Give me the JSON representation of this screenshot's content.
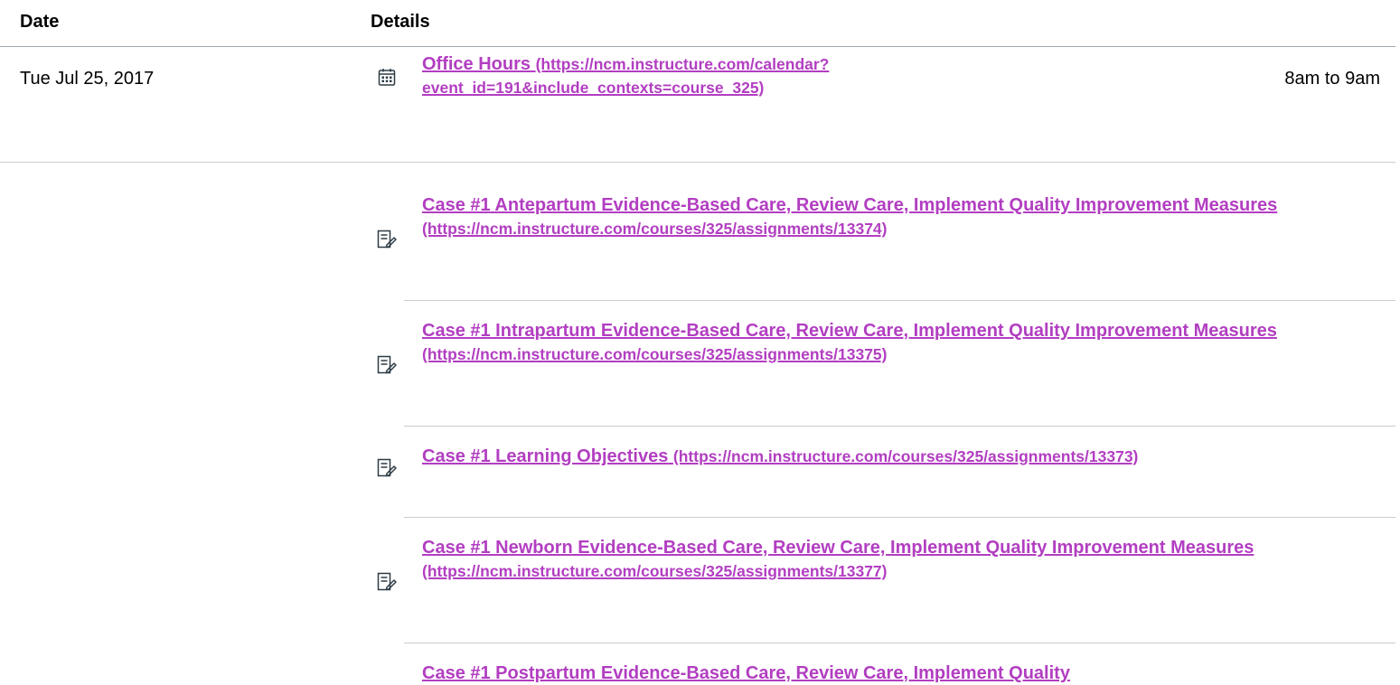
{
  "table": {
    "header": {
      "date_label": "Date",
      "details_label": "Details"
    },
    "rows": [
      {
        "date": "Tue Jul 25, 2017",
        "items": [
          {
            "type": "calendar-event",
            "icon": "calendar-icon",
            "title": "Office Hours",
            "url": "(https://ncm.instructure.com/calendar?event_id=191&include_contexts=course_325)",
            "time": "8am to 9am"
          }
        ]
      },
      {
        "date": "",
        "items": [
          {
            "type": "assignment",
            "icon": "assignment-icon",
            "title": "Case #1 Antepartum Evidence-Based Care, Review Care, Implement Quality Improvement Measures",
            "url": "(https://ncm.instructure.com/courses/325/assignments/13374)"
          },
          {
            "type": "assignment",
            "icon": "assignment-icon",
            "title": "Case #1 Intrapartum Evidence-Based Care, Review Care, Implement Quality Improvement Measures",
            "url": "(https://ncm.instructure.com/courses/325/assignments/13375)"
          },
          {
            "type": "assignment",
            "icon": "assignment-icon",
            "title": "Case #1 Learning Objectives",
            "url": "(https://ncm.instructure.com/courses/325/assignments/13373)"
          },
          {
            "type": "assignment",
            "icon": "assignment-icon",
            "title": "Case #1 Newborn Evidence-Based Care, Review Care, Implement Quality Improvement Measures",
            "url": "(https://ncm.instructure.com/courses/325/assignments/13377)"
          },
          {
            "type": "assignment",
            "icon": "assignment-icon",
            "title": "Case #1 Postpartum Evidence-Based Care, Review Care, Implement Quality",
            "url": ""
          }
        ]
      }
    ]
  },
  "colors": {
    "link": "#b23ec1",
    "divider": "#c7cdd1",
    "header_rule": "#9fa8ad"
  }
}
